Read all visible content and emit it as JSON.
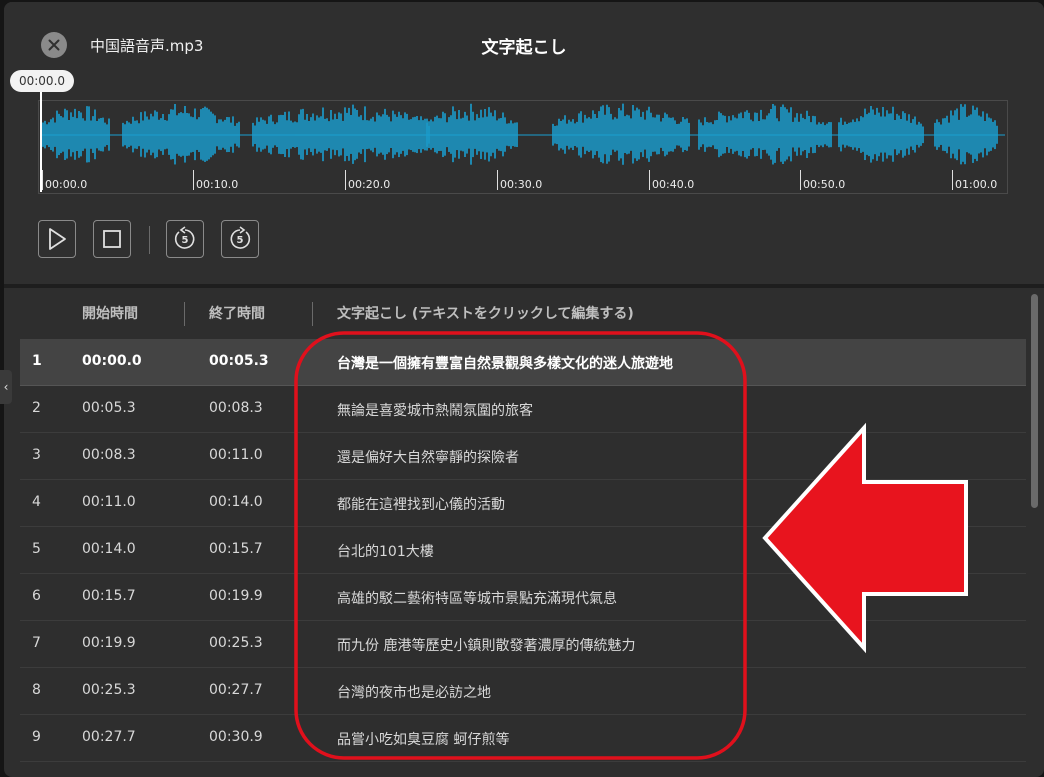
{
  "header": {
    "filename": "中国語音声.mp3",
    "title": "文字起こし",
    "current_time": "00:00.0"
  },
  "timeline": {
    "ticks": [
      "00:00.0",
      "00:10.0",
      "00:20.0",
      "00:30.0",
      "00:40.0",
      "00:50.0",
      "01:00.0"
    ],
    "waveform_color": "#1a9fd0"
  },
  "controls": {
    "play_icon": "play-icon",
    "stop_icon": "stop-icon",
    "rewind_label": "5",
    "forward_label": "5"
  },
  "table": {
    "columns": [
      "開始時間",
      "終了時間",
      "文字起こし (テキストをクリックして編集する)"
    ],
    "rows": [
      {
        "n": "1",
        "start": "00:00.0",
        "end": "00:05.3",
        "text": "台灣是一個擁有豐富自然景觀與多樣文化的迷人旅遊地"
      },
      {
        "n": "2",
        "start": "00:05.3",
        "end": "00:08.3",
        "text": "無論是喜愛城市熱鬧氛圍的旅客"
      },
      {
        "n": "3",
        "start": "00:08.3",
        "end": "00:11.0",
        "text": "還是偏好大自然寧靜的探險者"
      },
      {
        "n": "4",
        "start": "00:11.0",
        "end": "00:14.0",
        "text": "都能在這裡找到心儀的活動"
      },
      {
        "n": "5",
        "start": "00:14.0",
        "end": "00:15.7",
        "text": "台北的101大樓"
      },
      {
        "n": "6",
        "start": "00:15.7",
        "end": "00:19.9",
        "text": "高雄的駁二藝術特區等城市景點充滿現代氣息"
      },
      {
        "n": "7",
        "start": "00:19.9",
        "end": "00:25.3",
        "text": "而九份 鹿港等歷史小鎮則散發著濃厚的傳統魅力"
      },
      {
        "n": "8",
        "start": "00:25.3",
        "end": "00:27.7",
        "text": "台灣的夜市也是必訪之地"
      },
      {
        "n": "9",
        "start": "00:27.7",
        "end": "00:30.9",
        "text": "品嘗小吃如臭豆腐 蚵仔煎等"
      }
    ],
    "selected_row": "1"
  },
  "annotation": {
    "highlight_color": "#e0101c",
    "arrow_color": "#e8141e",
    "icon": "red-arrow-icon"
  }
}
